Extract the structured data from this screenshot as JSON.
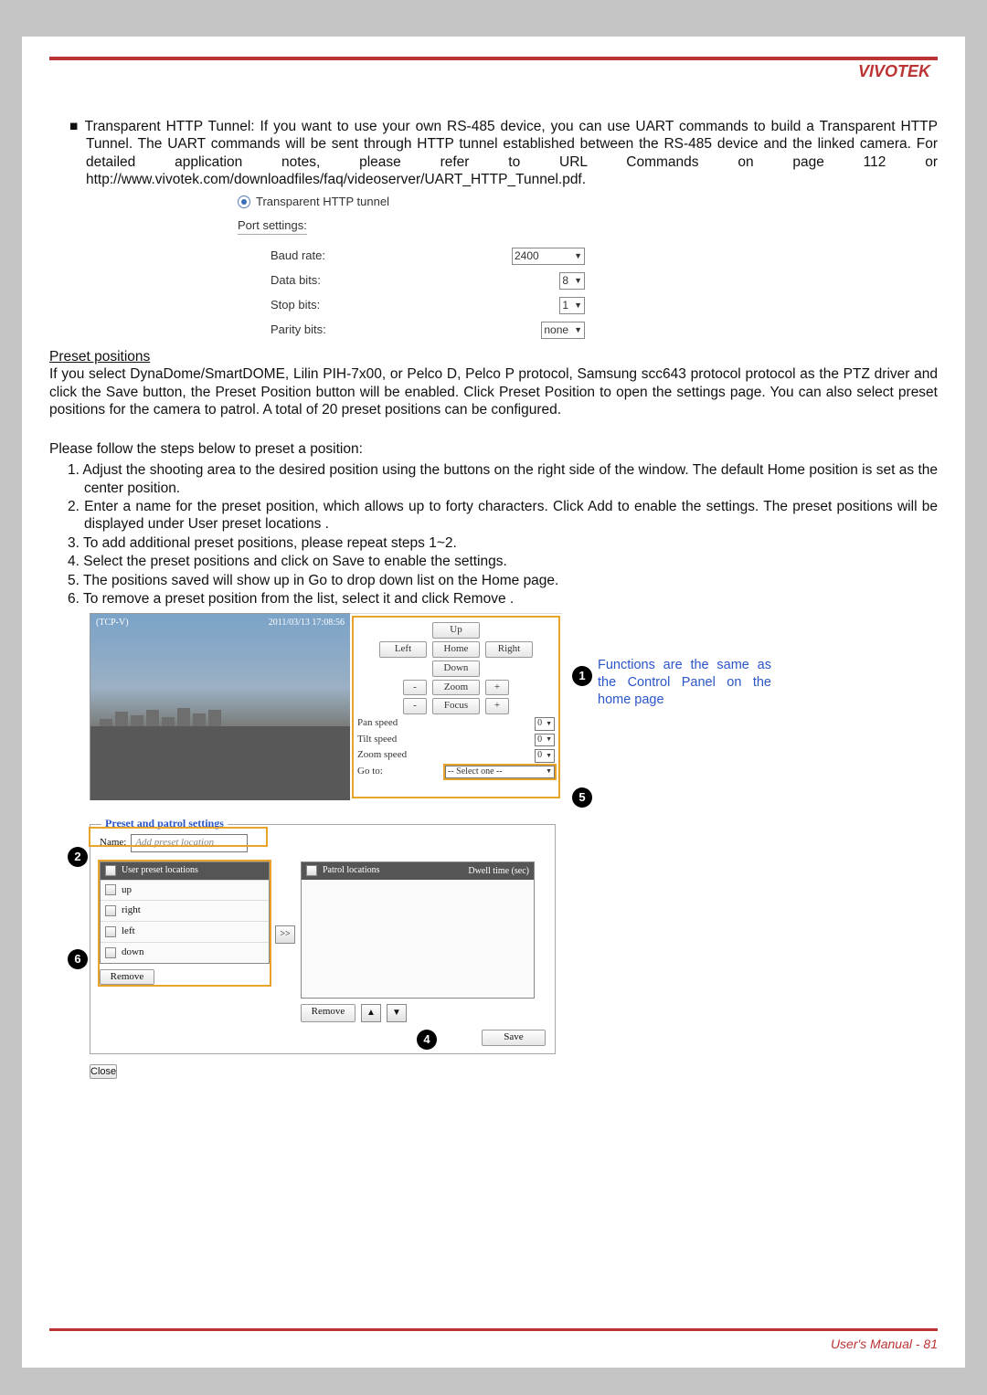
{
  "brand": "VIVOTEK",
  "intro": "■ Transparent HTTP Tunnel:  If you want to use your own RS-485 device, you can use UART commands to build a Transparent HTTP Tunnel. The UART commands will be sent through HTTP tunnel established between the RS-485 device and the linked camera. For detailed application notes, please refer to URL Commands on page 112 or http://www.vivotek.com/downloadfiles/faq/videoserver/UART_HTTP_Tunnel.pdf.",
  "radio_label": "Transparent HTTP tunnel",
  "port_title": "Port settings:",
  "port": {
    "baud_label": "Baud rate:",
    "baud_val": "2400",
    "data_label": "Data bits:",
    "data_val": "8",
    "stop_label": "Stop bits:",
    "stop_val": "1",
    "parity_label": "Parity bits:",
    "parity_val": "none"
  },
  "preset_heading": "Preset positions",
  "preset_para": "If you select DynaDome/SmartDOME, Lilin PIH-7x00, or Pelco D, Pelco P protocol, Samsung scc643 protocol protocol as the PTZ driver and click the Save button, the Preset Position   button will be enabled. Click Preset Position   to open the settings page. You can also select preset positions for the camera to patrol. A total of 20 preset positions can be configured.",
  "steps_intro": "Please follow the steps below to preset a position:",
  "steps": [
    "1. Adjust the shooting area to the desired position using the buttons on the right side of the window.  The default Home  position is set as the center position.",
    "2.  Enter a name for the preset position, which allows up to forty characters. Click Add  to enable the settings. The preset positions will be displayed under User preset locations   .",
    "3. To add additional preset positions, please repeat steps 1~2.",
    "4. Select the preset positions and click on Save to enable the settings.",
    "5. The positions saved will show up in Go to  drop down list on the Home page.",
    "6. To remove a preset position from the list, select it and click Remove ."
  ],
  "osd": {
    "src": "(TCP-V)",
    "time": "2011/03/13 17:08:56"
  },
  "ctrl": {
    "up": "Up",
    "left": "Left",
    "home": "Home",
    "right": "Right",
    "down": "Down",
    "zoom": "Zoom",
    "focus": "Focus",
    "minus": "-",
    "plus": "+",
    "pan": "Pan speed",
    "tilt": "Tilt speed",
    "zspd": "Zoom speed",
    "spd_val": "0",
    "goto": "Go to:",
    "goto_val": "-- Select one --"
  },
  "annot": "Functions are the same as the Control Panel on the home page",
  "badges": {
    "b1": "1",
    "b2": "2",
    "b4": "4",
    "b5": "5",
    "b6": "6"
  },
  "preset_panel": {
    "legend": "Preset and patrol settings",
    "name": "Name:",
    "placeholder": "Add preset location",
    "hdr_left": "User preset locations",
    "hdr_right_a": "Patrol locations",
    "hdr_right_b": "Dwell time (sec)",
    "rows": [
      "up",
      "right",
      "left",
      "down"
    ],
    "move": ">>",
    "remove": "Remove",
    "up_tri": "▲",
    "dn_tri": "▼",
    "save": "Save",
    "close": "Close"
  },
  "footer": "User's Manual - 81"
}
